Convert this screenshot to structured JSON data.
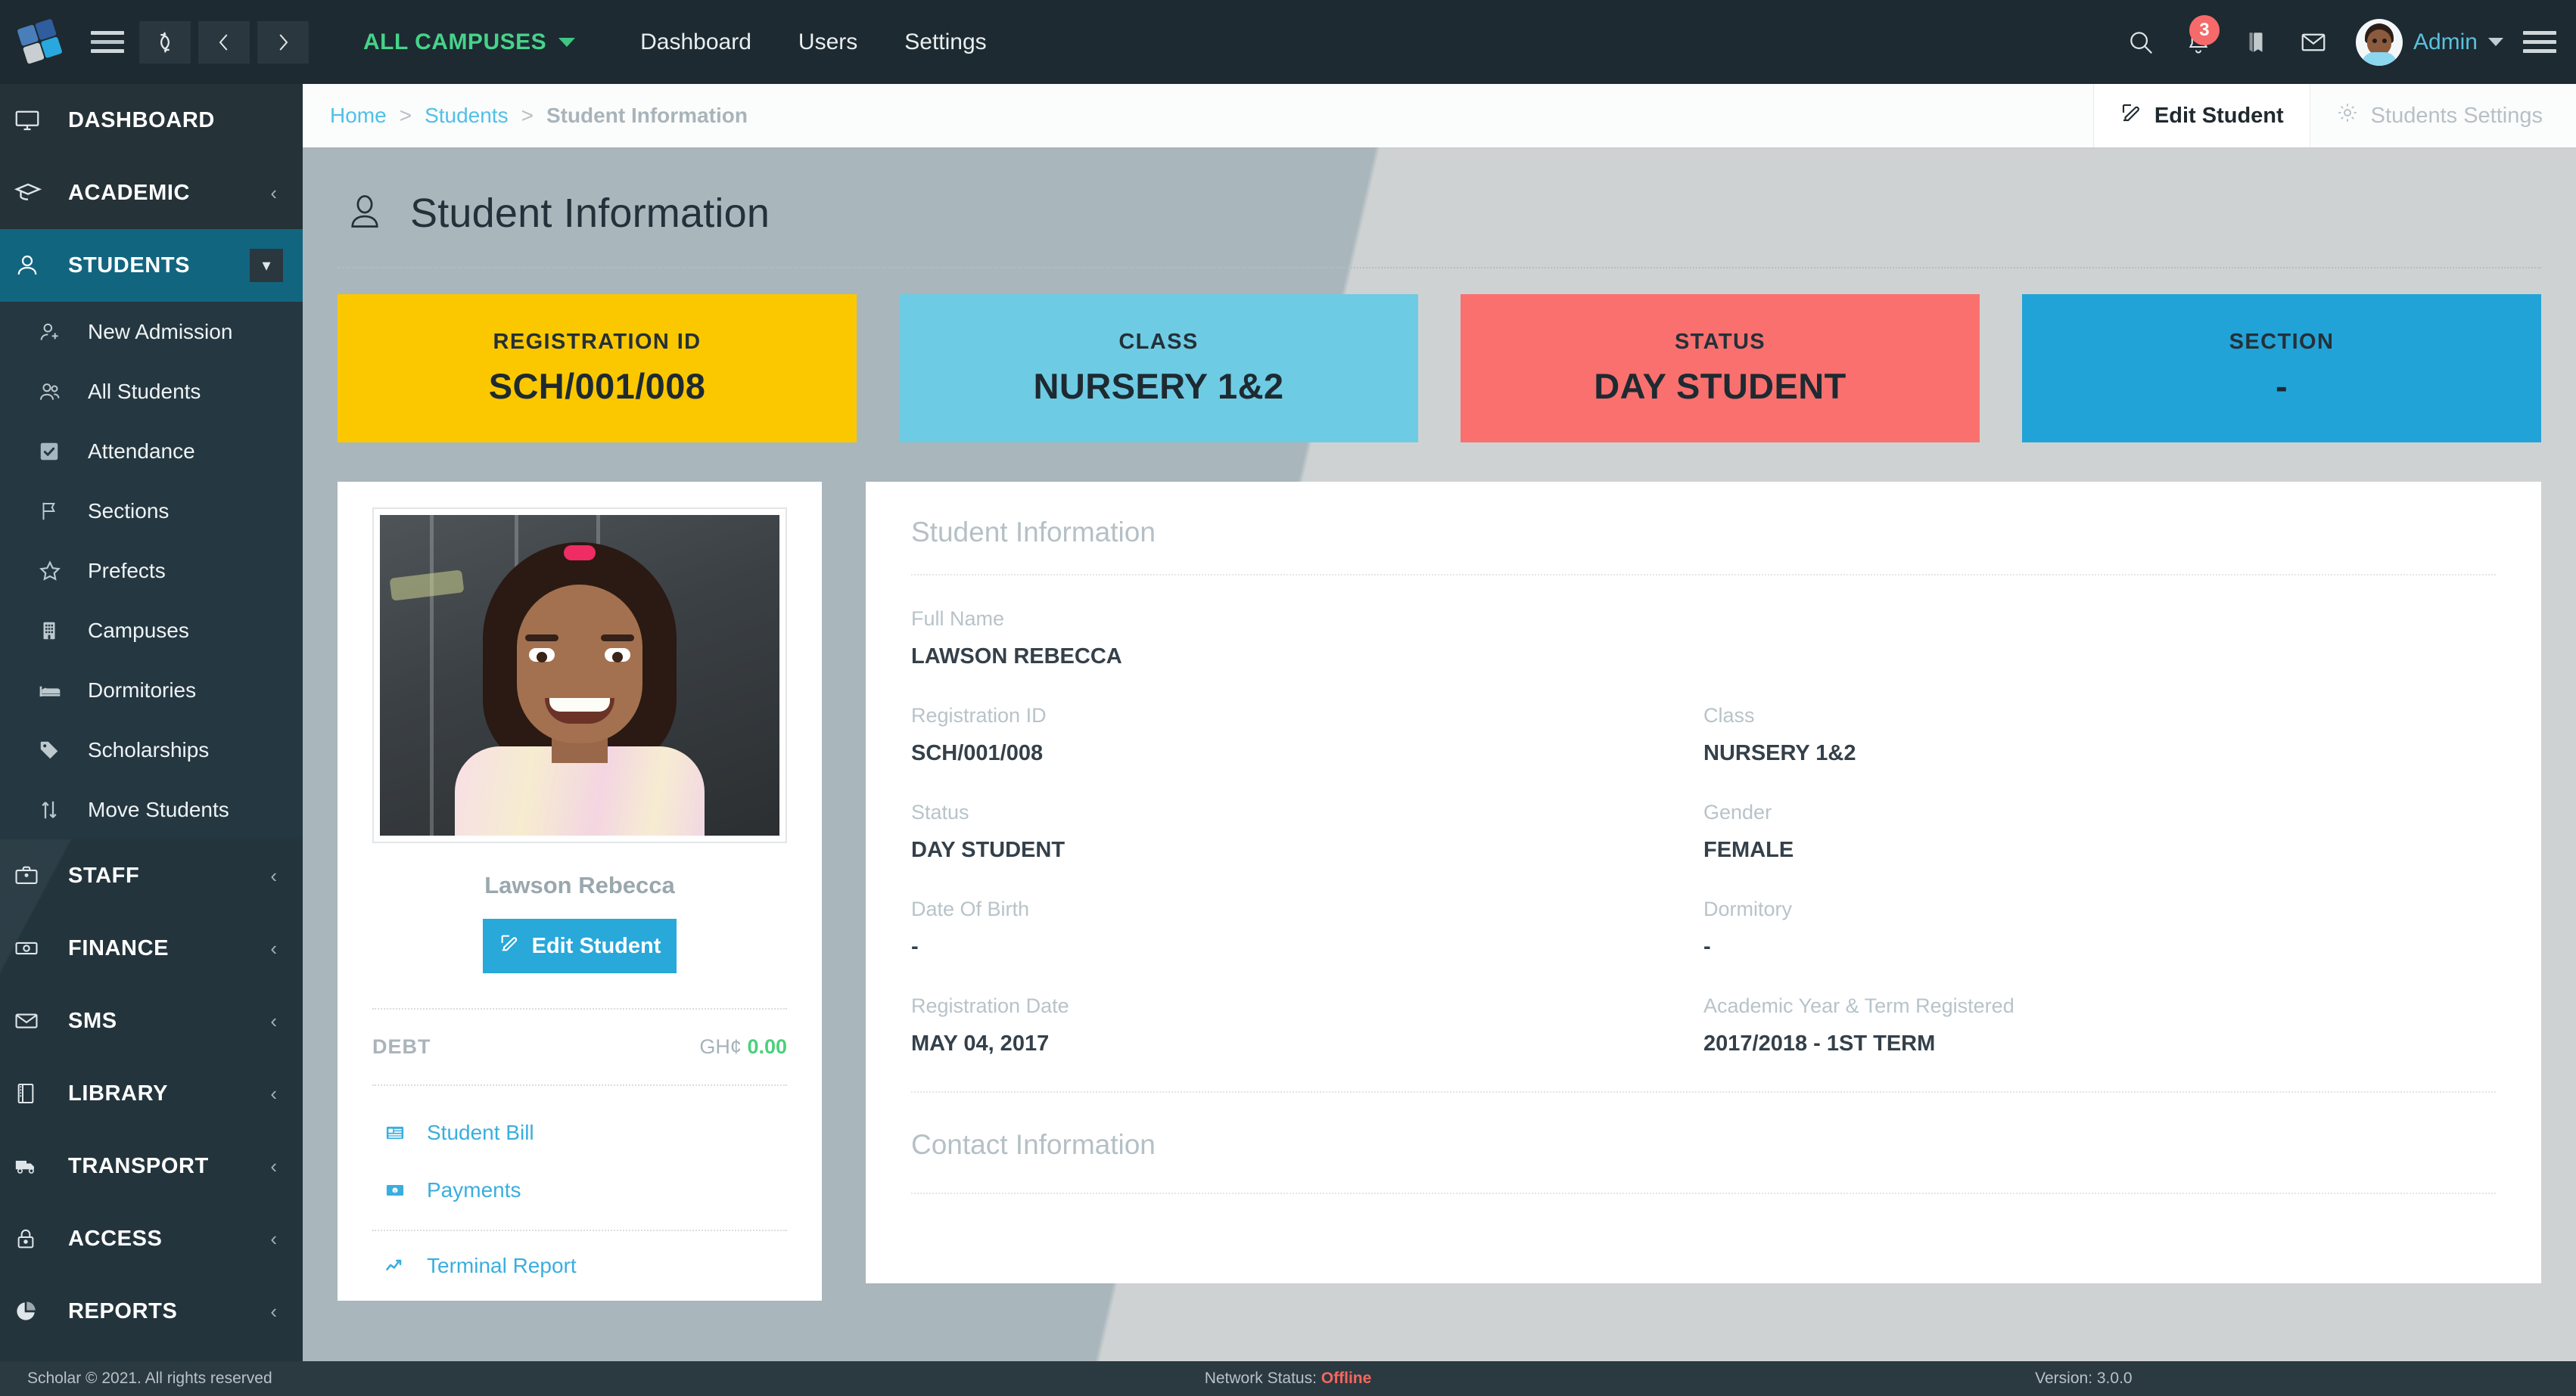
{
  "topbar": {
    "logo_name": "scholar-logo",
    "menu_icon": "hamburger-icon",
    "refresh_icon": "refresh-icon",
    "back_icon": "chevron-left-icon",
    "forward_icon": "chevron-right-icon",
    "campus_selector": "ALL CAMPUSES",
    "nav": [
      {
        "label": "Dashboard"
      },
      {
        "label": "Users"
      },
      {
        "label": "Settings"
      }
    ],
    "search_icon": "search-icon",
    "bell_icon": "bell-icon",
    "notification_count": "3",
    "book_icon": "book-icon",
    "mail_icon": "mail-icon",
    "avatar_name": "admin-avatar",
    "admin_label": "Admin"
  },
  "sidebar": {
    "groups": [
      {
        "label": "DASHBOARD",
        "icon": "monitor-icon",
        "chevron": false,
        "active": false
      },
      {
        "label": "ACADEMIC",
        "icon": "graduation-cap-icon",
        "chevron": true,
        "active": false
      },
      {
        "label": "STUDENTS",
        "icon": "user-icon",
        "chevron": false,
        "active": true,
        "dropdown": true
      }
    ],
    "students_items": [
      {
        "label": "New Admission",
        "icon": "user-plus-icon"
      },
      {
        "label": "All Students",
        "icon": "users-icon"
      },
      {
        "label": "Attendance",
        "icon": "check-square-icon"
      },
      {
        "label": "Sections",
        "icon": "flag-icon"
      },
      {
        "label": "Prefects",
        "icon": "star-icon"
      },
      {
        "label": "Campuses",
        "icon": "building-icon"
      },
      {
        "label": "Dormitories",
        "icon": "bed-icon"
      },
      {
        "label": "Scholarships",
        "icon": "tag-icon"
      },
      {
        "label": "Move Students",
        "icon": "arrows-updown-icon"
      }
    ],
    "bottom_groups": [
      {
        "label": "STAFF",
        "icon": "briefcase-icon"
      },
      {
        "label": "FINANCE",
        "icon": "money-icon"
      },
      {
        "label": "SMS",
        "icon": "envelope-icon"
      },
      {
        "label": "LIBRARY",
        "icon": "book-closed-icon"
      },
      {
        "label": "TRANSPORT",
        "icon": "truck-icon"
      },
      {
        "label": "ACCESS",
        "icon": "lock-icon"
      },
      {
        "label": "REPORTS",
        "icon": "pie-chart-icon"
      }
    ]
  },
  "breadcrumb": {
    "home": "Home",
    "students": "Students",
    "current": "Student Information",
    "separator": ">"
  },
  "header_actions": {
    "edit_student": "Edit Student",
    "edit_icon": "edit-pencil-icon",
    "students_settings": "Students Settings",
    "settings_icon": "gear-icon"
  },
  "page": {
    "title": "Student Information",
    "title_icon": "user-outline-icon"
  },
  "stat_cards": [
    {
      "label": "REGISTRATION ID",
      "value": "SCH/001/008",
      "color": "#fbc800"
    },
    {
      "label": "CLASS",
      "value": "NURSERY 1&2",
      "color": "#6ecbe4"
    },
    {
      "label": "STATUS",
      "value": "DAY STUDENT",
      "color": "#f9706e"
    },
    {
      "label": "SECTION",
      "value": "-",
      "color": "#22a3d8"
    }
  ],
  "profile_card": {
    "photo_name": "student-photo",
    "student_name": "Lawson Rebecca",
    "edit_button": "Edit Student",
    "edit_icon": "edit-pencil-icon",
    "debt_label": "DEBT",
    "debt_currency": "GH¢",
    "debt_amount": "0.00",
    "links": [
      {
        "label": "Student Bill",
        "icon": "bill-icon"
      },
      {
        "label": "Payments",
        "icon": "money-icon"
      },
      {
        "label": "Terminal Report",
        "icon": "chart-line-icon"
      }
    ]
  },
  "details": {
    "section_title": "Student Information",
    "contact_title": "Contact Information",
    "fields": [
      {
        "key": "Full Name",
        "value": "LAWSON REBECCA",
        "full": true
      },
      {
        "key": "Registration ID",
        "value": "SCH/001/008"
      },
      {
        "key": "Class",
        "value": "NURSERY 1&2"
      },
      {
        "key": "Status",
        "value": "DAY STUDENT"
      },
      {
        "key": "Gender",
        "value": "FEMALE"
      },
      {
        "key": "Date Of Birth",
        "value": "-"
      },
      {
        "key": "Dormitory",
        "value": "-"
      },
      {
        "key": "Registration Date",
        "value": "MAY 04, 2017"
      },
      {
        "key": "Academic Year & Term Registered",
        "value": "2017/2018 - 1ST TERM"
      }
    ]
  },
  "footer": {
    "copyright": "Scholar © 2021. All rights reserved",
    "network_label": "Network Status:",
    "network_status": "Offline",
    "version": "Version: 3.0.0"
  },
  "colors": {
    "brand_blue": "#29a8da",
    "sidebar_bg": "#253740",
    "topbar_bg": "#1d2a31",
    "accent_green": "#46d38a",
    "danger": "#f4675f",
    "link": "#4fc0e8"
  }
}
